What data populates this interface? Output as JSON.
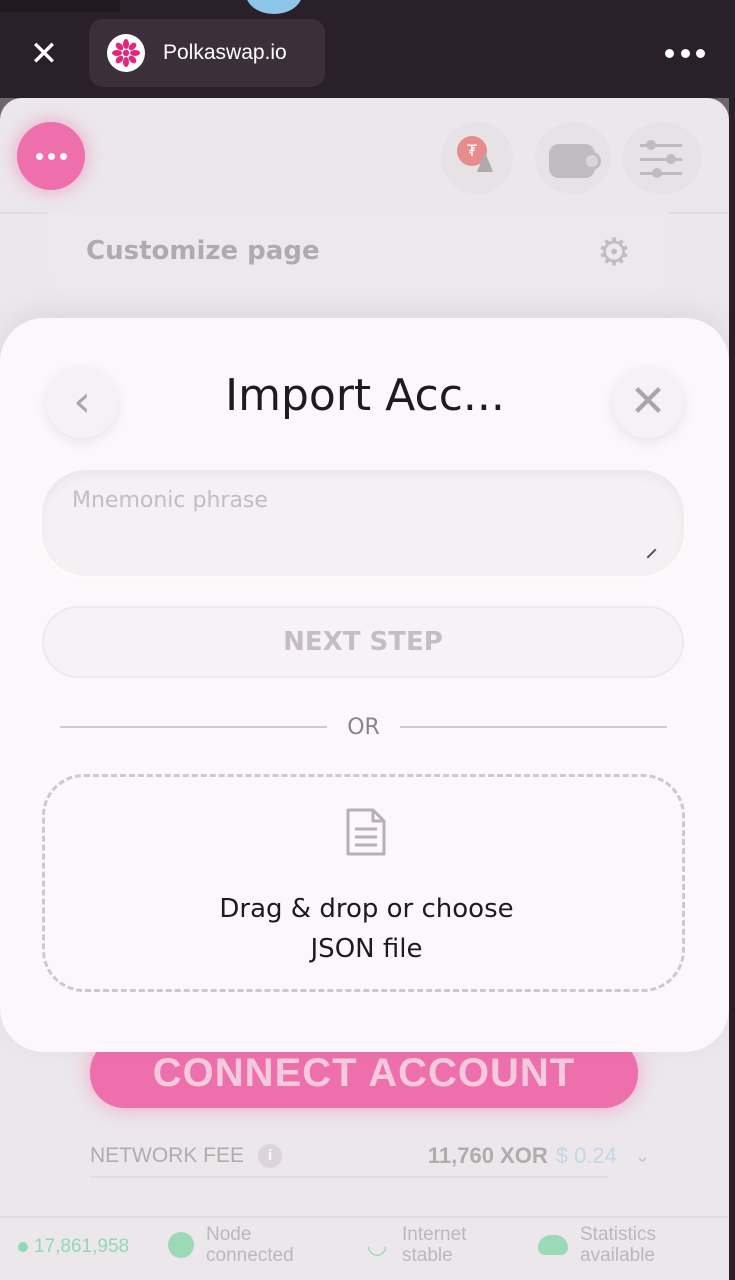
{
  "browser": {
    "site_title": "Polkaswap.io",
    "close_icon": "close-icon",
    "more_icon": "more-horizontal-icon"
  },
  "app": {
    "customize_label": "Customize page",
    "connect_label": "CONNECT ACCOUNT",
    "fee": {
      "label": "NETWORK FEE",
      "amount": "11,760 XOR",
      "usd": "$ 0.24"
    },
    "status": {
      "block": "17,861,958",
      "node_line1": "Node",
      "node_line2": "connected",
      "internet_line1": "Internet",
      "internet_line2": "stable",
      "stats_line1": "Statistics",
      "stats_line2": "available"
    }
  },
  "modal": {
    "title": "Import Acc...",
    "mnemonic_placeholder": "Mnemonic phrase",
    "mnemonic_value": "",
    "next_label": "NEXT STEP",
    "or_label": "OR",
    "drop_line1": "Drag & drop or choose",
    "drop_line2": "JSON file"
  },
  "colors": {
    "accent": "#ec2f8a",
    "status_green": "#5fcf96",
    "usd_blue": "#a9cde4"
  }
}
